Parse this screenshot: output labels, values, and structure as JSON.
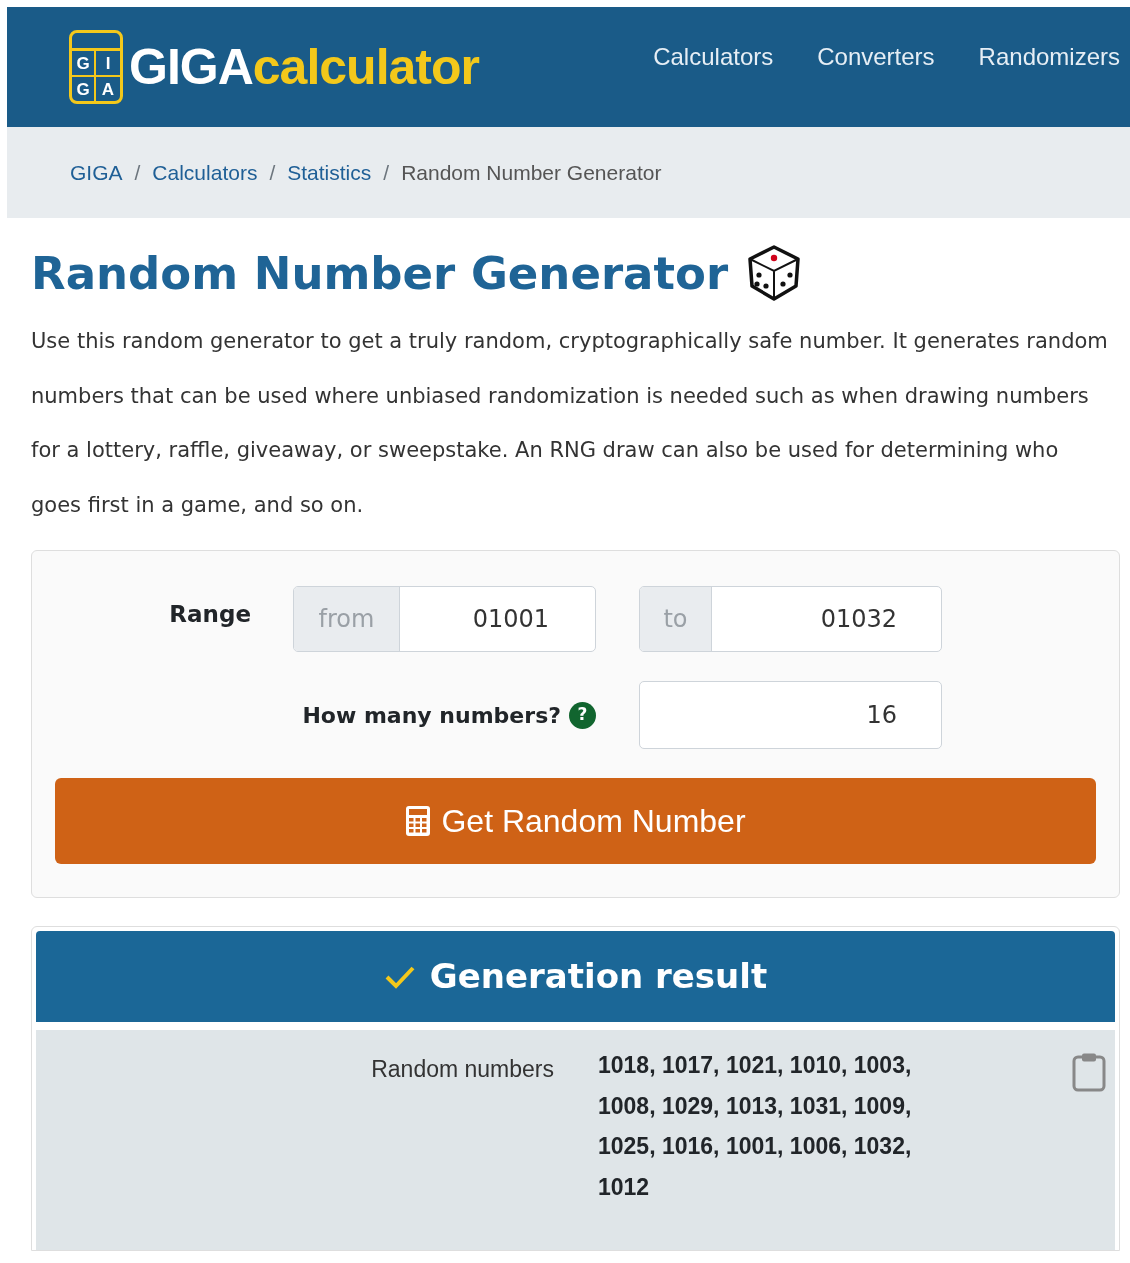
{
  "header": {
    "logo_letters": [
      "G",
      "I",
      "G",
      "A"
    ],
    "logo_word": "GIGA",
    "logo_suffix": "calculator",
    "nav": [
      "Calculators",
      "Converters",
      "Randomizers"
    ]
  },
  "breadcrumb": [
    {
      "label": "GIGA",
      "link": true
    },
    {
      "separator": "/",
      "label": "Calculators",
      "link": true
    },
    {
      "separator": "/",
      "label": "Statistics",
      "link": true
    },
    {
      "separator": "/",
      "label": "Random Number Generator",
      "link": false
    }
  ],
  "title": "Random Number Generator",
  "intro": "Use this random generator to get a truly random, cryptographically safe number. It generates random numbers that can be used where unbiased randomization is needed such as when drawing numbers for a lottery, raffle, giveaway, or sweepstake. An RNG draw can also be used for determining who goes first in a game, and so on.",
  "form": {
    "range_label": "Range",
    "from_prefix": "from",
    "from_value": "01001",
    "to_prefix": "to",
    "to_value": "01032",
    "count_label": "How many numbers?",
    "help_mark": "?",
    "count_value": "16",
    "button": "Get Random Number"
  },
  "result": {
    "title": "Generation result",
    "label": "Random numbers",
    "value": "1018, 1017, 1021, 1010, 1003, 1008, 1029, 1013, 1031, 1009, 1025, 1016, 1001, 1006, 1032, 1012"
  }
}
